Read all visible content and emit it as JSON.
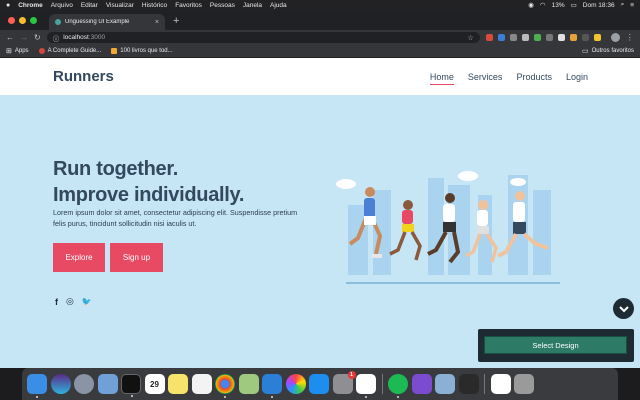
{
  "menubar": {
    "apple": "",
    "app": "Chrome",
    "menus": [
      "Arquivo",
      "Editar",
      "Visualizar",
      "Histórico",
      "Favoritos",
      "Pessoas",
      "Janela",
      "Ajuda"
    ],
    "battery": "13%",
    "clock": "Dom 18:36"
  },
  "browser": {
    "tab_title": "Unguessing UI Example",
    "tab_close": "×",
    "new_tab": "+",
    "url_host": "localhost",
    "url_port": ":3000",
    "star": "☆"
  },
  "bookmarks": {
    "apps": "Apps",
    "items": [
      "A Complete Guide...",
      "100 livros que tod..."
    ],
    "other": "Outros favoritos"
  },
  "site": {
    "brand": "Runners",
    "nav": [
      "Home",
      "Services",
      "Products",
      "Login"
    ],
    "headline_1": "Run together.",
    "headline_2": "Improve individually.",
    "body": "Lorem ipsum dolor sit amet, consectetur adipiscing elit. Suspendisse pretium felis purus, tincidunt sollicitudin nisi iaculis ut.",
    "explore": "Explore",
    "signup": "Sign up",
    "social": [
      "f",
      "◎",
      "🐦"
    ],
    "select_design": "Select Design"
  },
  "dock": {
    "calendar_day": "29",
    "mail_badge": "1"
  },
  "colors": {
    "accent": "#e84a64",
    "heading": "#34495e",
    "hero_bg": "#c6e5f5",
    "design_btn": "#2d7a67"
  }
}
